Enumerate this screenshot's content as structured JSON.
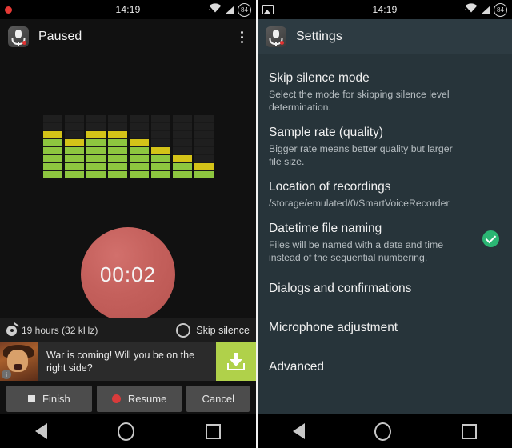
{
  "left_screen": {
    "statusbar": {
      "rec_indicator": "recording-dot",
      "time": "14:19",
      "battery_level": "84"
    },
    "appbar": {
      "icon": "voice-recorder-icon",
      "title": "Paused",
      "overflow": "overflow-menu-icon"
    },
    "equalizer": {
      "columns": 8,
      "rows": 8,
      "levels": [
        6,
        5,
        6,
        6,
        5,
        4,
        3,
        2
      ],
      "color_on": "#8dc63f",
      "color_top": "#d4c318",
      "color_off": "#1f1f1f"
    },
    "timer": {
      "value": "00:02",
      "color": "#b85450"
    },
    "info_strip": {
      "icon": "disc-icon",
      "text": "19 hours (32 kHz)",
      "skip_silence_label": "Skip silence",
      "skip_silence_checked": false
    },
    "ad": {
      "icon": "info-badge-icon",
      "text": "War is coming! Will you be on the right side?",
      "cta_icon": "download-icon",
      "cta_color": "#b0d14a"
    },
    "actions": [
      {
        "label": "Finish",
        "icon": "stop-square-icon"
      },
      {
        "label": "Resume",
        "icon": "record-circle-icon"
      },
      {
        "label": "Cancel",
        "icon": ""
      }
    ]
  },
  "right_screen": {
    "statusbar": {
      "left_icon": "image-icon",
      "time": "14:19",
      "battery_level": "84"
    },
    "appbar": {
      "icon": "voice-recorder-icon",
      "title": "Settings"
    },
    "settings": [
      {
        "title": "Skip silence mode",
        "desc": "Select the mode for skipping silence level determination.",
        "checked": false
      },
      {
        "title": "Sample rate (quality)",
        "desc": "Bigger rate means better quality but larger file size.",
        "checked": false
      },
      {
        "title": "Location of recordings",
        "desc": "/storage/emulated/0/SmartVoiceRecorder",
        "checked": false
      },
      {
        "title": "Datetime file naming",
        "desc": "Files will be named with a date and time instead of the sequential numbering.",
        "checked": true
      },
      {
        "title": "Dialogs and confirmations",
        "desc": "",
        "checked": false
      },
      {
        "title": "Microphone adjustment",
        "desc": "",
        "checked": false
      },
      {
        "title": "Advanced",
        "desc": "",
        "checked": false
      }
    ],
    "check_color": "#2bb673"
  },
  "navbar": {
    "back": "back-triangle-icon",
    "home": "home-circle-icon",
    "recents": "recents-square-icon"
  }
}
